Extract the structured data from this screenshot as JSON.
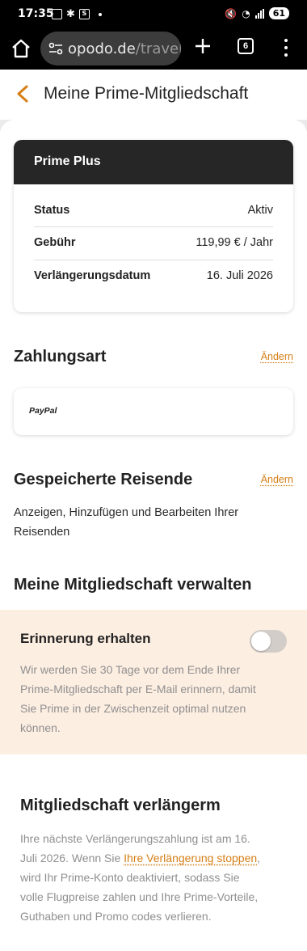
{
  "status_bar": {
    "time": "17:35",
    "icons": [
      "screenshot-icon",
      "slack-icon",
      "s-app-icon"
    ],
    "battery": "61"
  },
  "browser": {
    "url_domain": "opodo.de",
    "url_path": "/travel/p",
    "tab_count": "6"
  },
  "header": {
    "title": "Meine Prime-Mitgliedschaft"
  },
  "prime_card": {
    "title": "Prime Plus",
    "rows": [
      {
        "label": "Status",
        "value": "Aktiv"
      },
      {
        "label": "Gebühr",
        "value": "119,99 € / Jahr"
      },
      {
        "label": "Verlängerungsdatum",
        "value": "16. Juli 2026"
      }
    ]
  },
  "payment": {
    "title": "Zahlungsart",
    "change_label": "Ändern",
    "method": "PayPal"
  },
  "travellers": {
    "title": "Gespeicherte Reisende",
    "change_label": "Ändern",
    "line1": "Anzeigen, Hinzufügen und Bearbeiten Ihrer",
    "line2": "Reisenden"
  },
  "manage": {
    "title": "Meine Mitgliedschaft verwalten"
  },
  "reminder": {
    "title": "Erinnerung erhalten",
    "enabled": false,
    "lines": [
      "Wir werden Sie 30 Tage vor dem Ende Ihrer",
      "Prime-Mitgliedschaft per E-Mail erinnern, damit",
      "Sie Prime in der Zwischenzeit optimal nutzen",
      "können."
    ]
  },
  "renewal": {
    "title": "Mitgliedschaft verlängerm",
    "line1": "Ihre nächste Verlängerungszahlung ist am 16.",
    "line2_prefix": "Juli 2026. Wenn Sie ",
    "stop_link": "Ihre Verlängerung stoppen",
    "line2_suffix": ",",
    "line3": "wird Ihr Prime-Konto deaktiviert, sodass Sie",
    "line4": "volle Flugpreise zahlen und Ihre Prime-Vorteile,",
    "line5": "Guthaben und Promo codes verlieren."
  },
  "colors": {
    "accent": "#d67f16",
    "card_header": "#262626",
    "reminder_bg": "#fdeee2"
  }
}
